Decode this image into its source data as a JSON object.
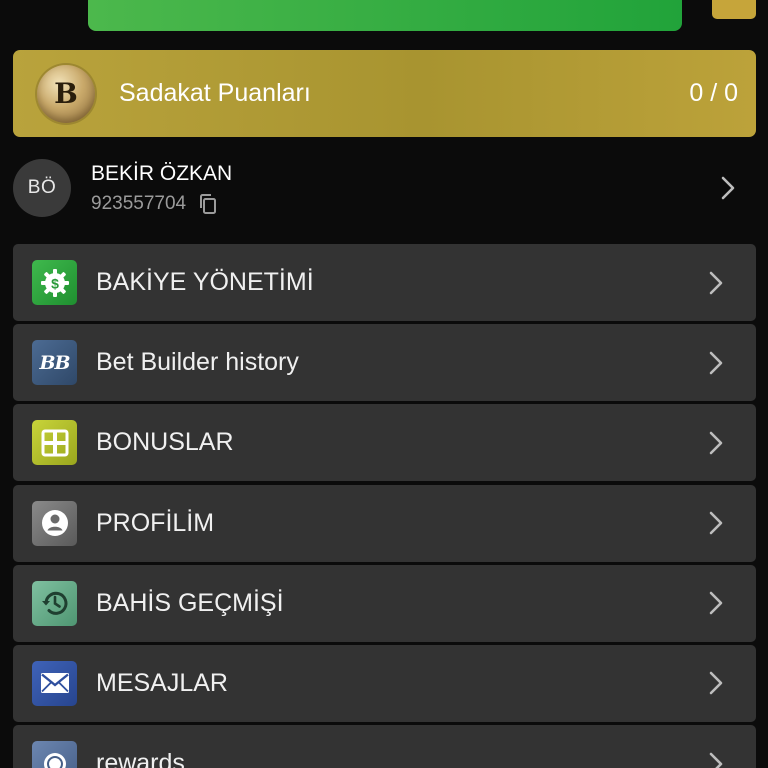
{
  "colors": {
    "background": "#0b0b0b",
    "card": "#333333",
    "loyalty_gold": "#b9a33c",
    "top_green": "#2fab40"
  },
  "loyalty": {
    "badge_letter": "B",
    "title": "Sadakat Puanları",
    "value": "0 / 0"
  },
  "user": {
    "initials": "BÖ",
    "name": "BEKİR ÖZKAN",
    "id": "923557704",
    "copy_icon": "copy-icon",
    "chevron_icon": "chevron-right-icon"
  },
  "menu": {
    "items": [
      {
        "label": "BAKİYE YÖNETİMİ",
        "icon": "balance-gear-dollar-icon"
      },
      {
        "label": "Bet Builder history",
        "icon": "bet-builder-icon",
        "icon_text": "BB"
      },
      {
        "label": "BONUSLAR",
        "icon": "bonus-gift-icon"
      },
      {
        "label": "PROFİLİM",
        "icon": "profile-user-icon"
      },
      {
        "label": "BAHİS GEÇMİŞİ",
        "icon": "history-clock-icon"
      },
      {
        "label": "MESAJLAR",
        "icon": "envelope-icon"
      },
      {
        "label": "rewards",
        "icon": "rewards-icon"
      }
    ]
  }
}
